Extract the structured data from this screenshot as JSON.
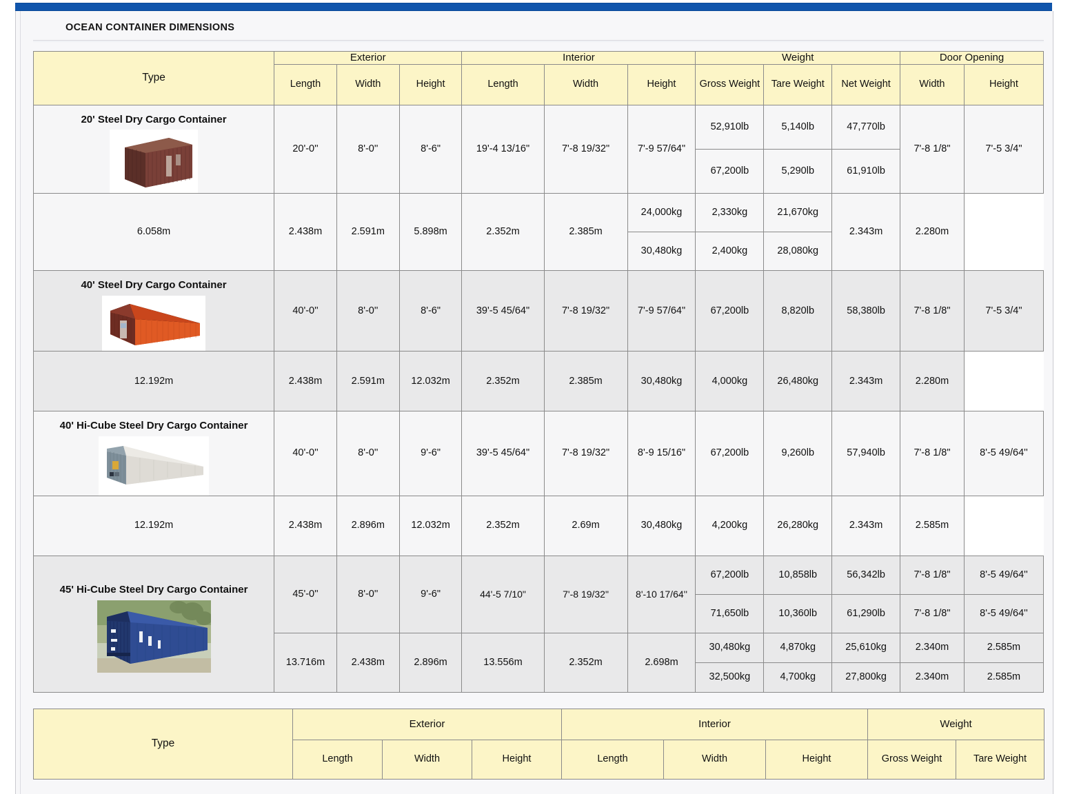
{
  "section": {
    "title": "OCEAN CONTAINER DIMENSIONS"
  },
  "colors": {
    "topbar": "#1055ac",
    "header_bg": "#fcf5c7",
    "row_light": "#f6f6f7",
    "row_dark": "#e9e9ea",
    "border": "#8a8a8a"
  },
  "table": {
    "group_headers": {
      "type": "Type",
      "exterior": "Exterior",
      "interior": "Interior",
      "weight": "Weight",
      "door_opening": "Door Opening"
    },
    "sub_headers": {
      "ext_length": "Length",
      "ext_width": "Width",
      "ext_height": "Height",
      "int_length": "Length",
      "int_width": "Width",
      "int_height": "Height",
      "gross_weight": "Gross Weight",
      "tare_weight": "Tare Weight",
      "net_weight": "Net Weight",
      "door_width": "Width",
      "door_height": "Height"
    },
    "rows": [
      {
        "type": "20' Steel Dry Cargo Container",
        "image": "container-20ft-brown",
        "imperial": {
          "ext_length": "20'-0''",
          "ext_width": "8'-0''",
          "ext_height": "8'-6\"",
          "int_length": "19'-4 13/16\"",
          "int_width": "7'-8 19/32\"",
          "int_height": "7'-9 57/64\"",
          "gross_weight_1": "52,910lb",
          "tare_weight_1": "5,140lb",
          "net_weight_1": "47,770lb",
          "gross_weight_2": "67,200lb",
          "tare_weight_2": "5,290lb",
          "net_weight_2": "61,910lb",
          "door_width": "7'-8 1/8\"",
          "door_height": "7'-5 3/4\""
        },
        "metric": {
          "ext_length": "6.058m",
          "ext_width": "2.438m",
          "ext_height": "2.591m",
          "int_length": "5.898m",
          "int_width": "2.352m",
          "int_height": "2.385m",
          "gross_weight_1": "24,000kg",
          "tare_weight_1": "2,330kg",
          "net_weight_1": "21,670kg",
          "gross_weight_2": "30,480kg",
          "tare_weight_2": "2,400kg",
          "net_weight_2": "28,080kg",
          "door_width": "2.343m",
          "door_height": "2.280m"
        }
      },
      {
        "type": "40' Steel Dry Cargo Container",
        "image": "container-40ft-orange",
        "imperial": {
          "ext_length": "40'-0''",
          "ext_width": "8'-0''",
          "ext_height": "8'-6\"",
          "int_length": "39'-5 45/64\"",
          "int_width": "7'-8 19/32\"",
          "int_height": "7'-9 57/64\"",
          "gross_weight": "67,200lb",
          "tare_weight": "8,820lb",
          "net_weight": "58,380lb",
          "door_width": "7'-8 1/8\"",
          "door_height": "7'-5 3/4\""
        },
        "metric": {
          "ext_length": "12.192m",
          "ext_width": "2.438m",
          "ext_height": "2.591m",
          "int_length": "12.032m",
          "int_width": "2.352m",
          "int_height": "2.385m",
          "gross_weight": "30,480kg",
          "tare_weight": "4,000kg",
          "net_weight": "26,480kg",
          "door_width": "2.343m",
          "door_height": "2.280m"
        }
      },
      {
        "type": "40' Hi-Cube Steel Dry Cargo Container",
        "image": "container-40ft-hicube-white",
        "imperial": {
          "ext_length": "40'-0''",
          "ext_width": "8'-0''",
          "ext_height": "9'-6\"",
          "int_length": "39'-5 45/64\"",
          "int_width": "7'-8 19/32\"",
          "int_height": "8'-9 15/16\"",
          "gross_weight": "67,200lb",
          "tare_weight": "9,260lb",
          "net_weight": "57,940lb",
          "door_width": "7'-8 1/8\"",
          "door_height": "8'-5 49/64''"
        },
        "metric": {
          "ext_length": "12.192m",
          "ext_width": "2.438m",
          "ext_height": "2.896m",
          "int_length": "12.032m",
          "int_width": "2.352m",
          "int_height": "2.69m",
          "gross_weight": "30,480kg",
          "tare_weight": "4,200kg",
          "net_weight": "26,280kg",
          "door_width": "2.343m",
          "door_height": "2.585m"
        }
      },
      {
        "type": "45' Hi-Cube Steel Dry Cargo Container",
        "image": "container-45ft-hicube-blue",
        "imperial": {
          "ext_length": "45'-0''",
          "ext_width": "8'-0''",
          "ext_height": "9'-6\"",
          "int_length": "44'-5 7/10\"",
          "int_width": "7'-8 19/32\"",
          "int_height": "8'-10 17/64''",
          "gross_weight_1": "67,200lb",
          "tare_weight_1": "10,858lb",
          "net_weight_1": "56,342lb",
          "door_width_1": "7'-8 1/8\"",
          "door_height_1": "8'-5 49/64''",
          "gross_weight_2": "71,650lb",
          "tare_weight_2": "10,360lb",
          "net_weight_2": "61,290lb",
          "door_width_2": "7'-8 1/8\"",
          "door_height_2": "8'-5 49/64''"
        },
        "metric": {
          "ext_length": "13.716m",
          "ext_width": "2.438m",
          "ext_height": "2.896m",
          "int_length": "13.556m",
          "int_width": "2.352m",
          "int_height": "2.698m",
          "gross_weight_1": "30,480kg",
          "tare_weight_1": "4,870kg",
          "net_weight_1": "25,610kg",
          "door_width_1": "2.340m",
          "door_height_1": "2.585m",
          "gross_weight_2": "32,500kg",
          "tare_weight_2": "4,700kg",
          "net_weight_2": "27,800kg",
          "door_width_2": "2.340m",
          "door_height_2": "2.585m"
        }
      }
    ]
  },
  "bottom_table": {
    "group_headers": {
      "type": "Type",
      "exterior": "Exterior",
      "interior": "Interior",
      "weight": "Weight"
    },
    "sub_headers": {
      "ext_length": "Length",
      "ext_width": "Width",
      "ext_height": "Height",
      "int_length": "Length",
      "int_width": "Width",
      "int_height": "Height",
      "gross_weight": "Gross Weight",
      "tare_weight": "Tare Weight"
    }
  }
}
